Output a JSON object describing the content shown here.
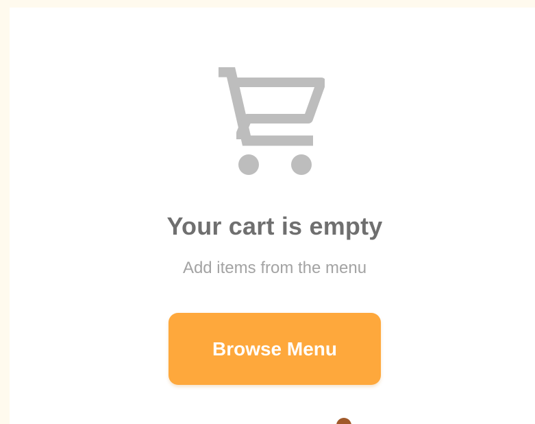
{
  "empty_state": {
    "icon": "shopping-cart-icon",
    "title": "Your cart is empty",
    "subtitle": "Add items from the menu"
  },
  "actions": {
    "browse_label": "Browse Menu"
  },
  "colors": {
    "page_background": "#FFFAEE",
    "card_background": "#FFFFFF",
    "icon": "#BDBDBD",
    "title": "#6F6F6F",
    "subtitle": "#A3A3A3",
    "accent": "#FEA83C",
    "button_text": "#FFFFFF",
    "indicator": "#A0592A"
  }
}
